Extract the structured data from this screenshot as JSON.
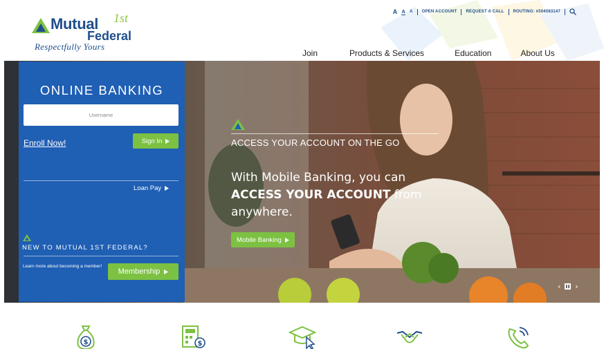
{
  "logo": {
    "name_line1": "Mutual",
    "name_sup": "1st",
    "name_line2": "Federal",
    "tagline": "Respectfully Yours"
  },
  "utility": {
    "font_sizes": [
      "A",
      "A",
      "A"
    ],
    "open_account": "OPEN ACCOUNT",
    "request_call": "REQUEST A CALL",
    "routing": "ROUTING: #304083147"
  },
  "nav": [
    "Join",
    "Products & Services",
    "Education",
    "About Us"
  ],
  "banking": {
    "title": "ONLINE BANKING",
    "username_placeholder": "Username",
    "enroll_label": "Enroll Now!",
    "signin_label": "Sign In",
    "loanpay_label": "Loan Pay",
    "new_title": "NEW TO MUTUAL 1ST FEDERAL?",
    "learn_text": "Learn more about becoming a member!",
    "membership_label": "Membership"
  },
  "slide": {
    "kicker": "ACCESS YOUR ACCOUNT ON THE GO",
    "body_pre": "With Mobile Banking, you can",
    "body_bold": "ACCESS YOUR ACCOUNT",
    "body_post1": " from",
    "body_post2": "anywhere.",
    "button_label": "Mobile Banking"
  },
  "slider_controls": {
    "prev": "‹",
    "next": "›"
  },
  "service_icons": [
    "money-bag-icon",
    "calculator-money-icon",
    "graduation-cap-icon",
    "handshake-icon",
    "phone-call-icon"
  ],
  "colors": {
    "brand_blue": "#1f5fb4",
    "brand_navy": "#1f4e8c",
    "accent_green": "#7cc142"
  }
}
